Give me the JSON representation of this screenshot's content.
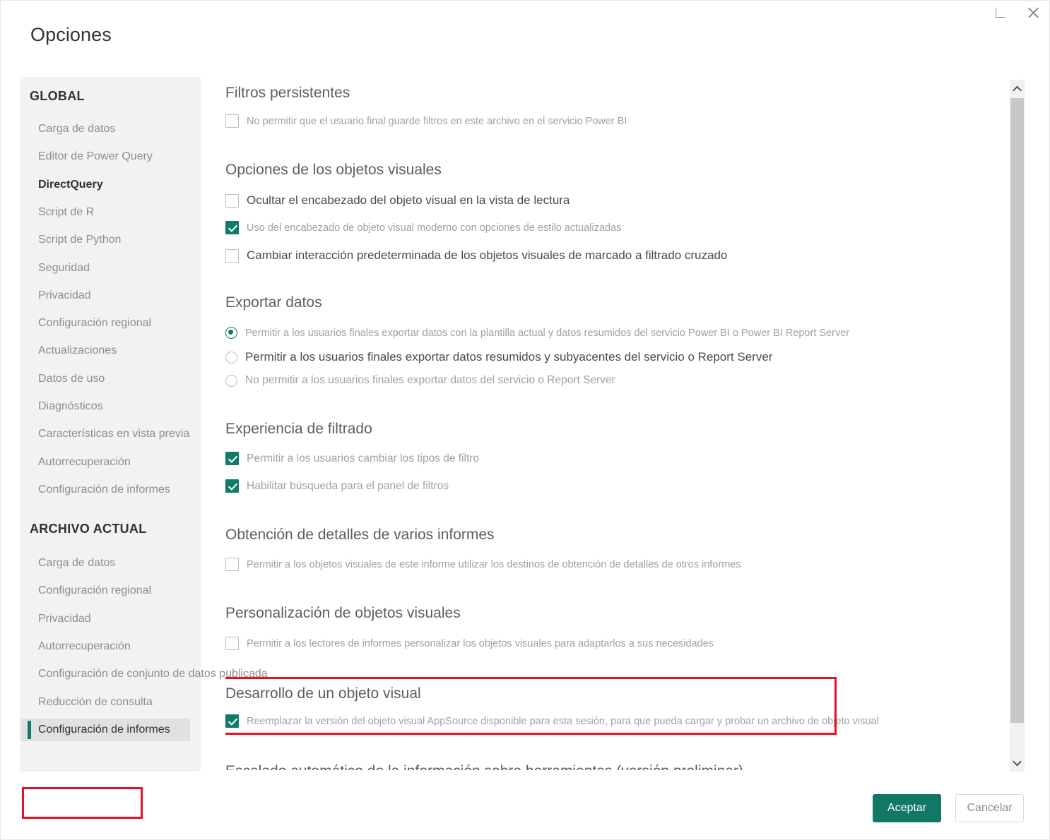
{
  "window": {
    "title": "Opciones",
    "restore_label": "restore",
    "close_label": "close"
  },
  "sidebar": {
    "groups": [
      {
        "label": "GLOBAL"
      },
      {
        "label": "ARCHIVO ACTUAL"
      }
    ],
    "global_items": [
      {
        "label": "Carga de datos"
      },
      {
        "label": "Editor de Power Query"
      },
      {
        "label": "DirectQuery"
      },
      {
        "label": "Script de R"
      },
      {
        "label": "Script de Python"
      },
      {
        "label": "Seguridad"
      },
      {
        "label": "Privacidad"
      },
      {
        "label": "Configuración regional"
      },
      {
        "label": "Actualizaciones"
      },
      {
        "label": "Datos de uso"
      },
      {
        "label": "Diagnósticos"
      },
      {
        "label": "Características en vista previa"
      },
      {
        "label": "Autorrecuperación"
      },
      {
        "label": "Configuración de informes"
      }
    ],
    "current_file_items": [
      {
        "label": "Carga de datos"
      },
      {
        "label": "Configuración regional"
      },
      {
        "label": "Privacidad"
      },
      {
        "label": "Autorrecuperación"
      },
      {
        "label": "Configuración de conjunto de datos publicada"
      },
      {
        "label": "Reducción de consulta"
      },
      {
        "label": "Configuración de informes"
      }
    ],
    "selected": "Configuración de informes"
  },
  "content": {
    "sections": [
      {
        "title": "Filtros persistentes",
        "options": [
          {
            "type": "checkbox",
            "checked": false,
            "label": "No permitir que el usuario final guarde filtros en este archivo en el servicio Power BI"
          }
        ]
      },
      {
        "title": "Opciones de los objetos visuales",
        "options": [
          {
            "type": "checkbox",
            "checked": false,
            "label": "Ocultar el encabezado del objeto visual en la vista de lectura"
          },
          {
            "type": "checkbox",
            "checked": true,
            "label": "Uso del encabezado de objeto visual moderno con opciones de estilo actualizadas"
          },
          {
            "type": "checkbox",
            "checked": false,
            "label": "Cambiar interacción predeterminada de los objetos visuales de marcado a filtrado cruzado"
          }
        ]
      },
      {
        "title": "Exportar datos",
        "options": [
          {
            "type": "radio",
            "checked": true,
            "label": "Permitir a los usuarios finales exportar datos con la plantilla actual y datos resumidos del servicio Power BI o Power BI Report Server"
          },
          {
            "type": "radio",
            "checked": false,
            "label": "Permitir a los usuarios finales exportar datos resumidos y subyacentes del servicio o Report Server"
          },
          {
            "type": "radio",
            "checked": false,
            "label": "No permitir a los usuarios finales exportar datos del servicio o Report Server"
          }
        ]
      },
      {
        "title": "Experiencia de filtrado",
        "options": [
          {
            "type": "checkbox",
            "checked": true,
            "label": "Permitir a los usuarios cambiar los tipos de filtro"
          },
          {
            "type": "checkbox",
            "checked": true,
            "label": "Habilitar búsqueda para el panel de filtros"
          }
        ]
      },
      {
        "title": "Obtención de detalles de varios informes",
        "options": [
          {
            "type": "checkbox",
            "checked": false,
            "label": "Permitir a los objetos visuales de este informe utilizar los destinos de obtención de detalles de otros informes"
          }
        ]
      },
      {
        "title": "Personalización de objetos visuales",
        "options": [
          {
            "type": "checkbox",
            "checked": false,
            "label": "Permitir a los lectores de informes personalizar los objetos visuales para adaptarlos a sus necesidades"
          }
        ]
      },
      {
        "title": "Desarrollo de un objeto visual",
        "options": [
          {
            "type": "checkbox",
            "checked": true,
            "label": "Reemplazar la versión del objeto visual AppSource disponible para esta sesión, para que pueda cargar y probar un archivo de objeto visual"
          }
        ]
      },
      {
        "title": "Escalado automático de la información sobre herramientas (versión preliminar)",
        "options": []
      }
    ]
  },
  "scrollbar": {
    "up_icon": "chevron-up-icon",
    "down_icon": "chevron-down-icon"
  },
  "footer": {
    "accept_label": "Aceptar",
    "cancel_label": "Cancelar"
  },
  "colors": {
    "accent": "#107c67",
    "primary_button": "#117865",
    "highlight": "#e81123",
    "sidebar_bg": "#f3f2f1",
    "selected_item_bg": "#e1e1e1"
  }
}
